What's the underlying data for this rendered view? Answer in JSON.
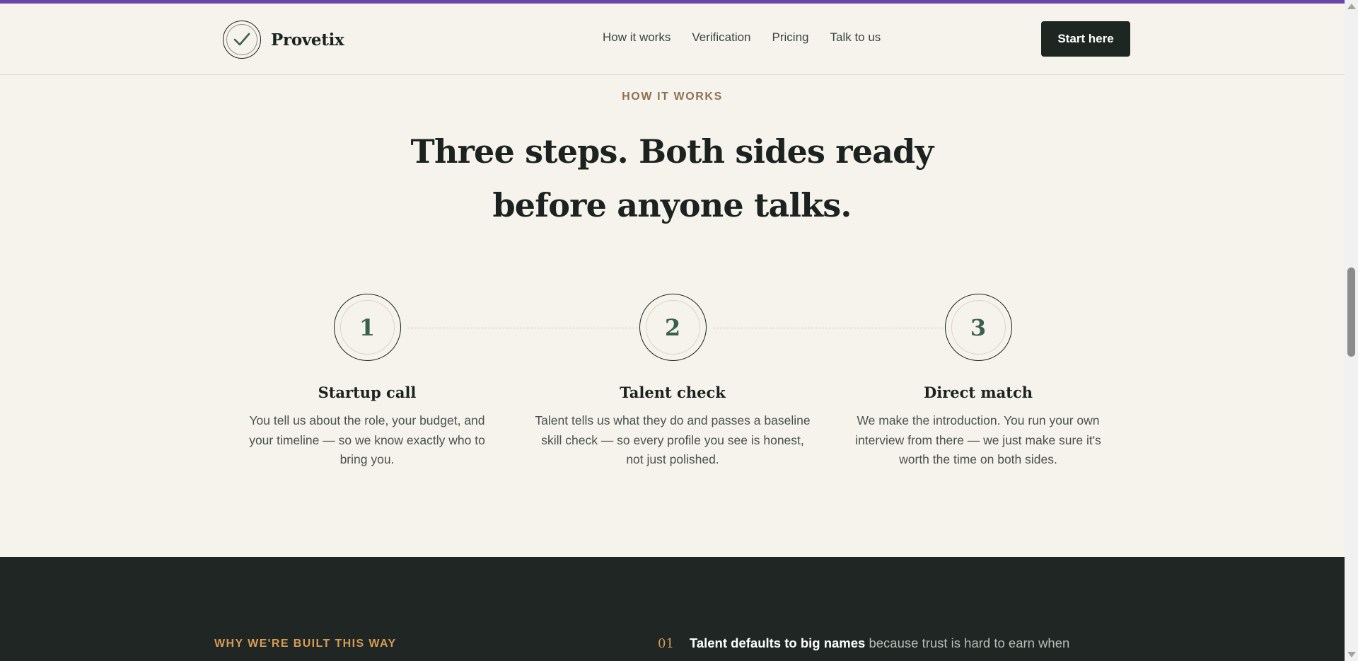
{
  "brand": {
    "name": "Provetix",
    "logo_icon": "check-mark-icon"
  },
  "nav": {
    "links": [
      "How it works",
      "Verification",
      "Pricing",
      "Talk to us"
    ],
    "cta_label": "Start here"
  },
  "how_it_works": {
    "eyebrow": "HOW IT WORKS",
    "headline": "Three steps. Both sides ready before anyone talks.",
    "steps": [
      {
        "number": "1",
        "title": "Startup call",
        "text": "You tell us about the role, your budget, and your timeline — so we know exactly who to bring you."
      },
      {
        "number": "2",
        "title": "Talent check",
        "text": "Talent tells us what they do and passes a baseline skill check — so every profile you see is honest, not just polished."
      },
      {
        "number": "3",
        "title": "Direct match",
        "text": "We make the introduction. You run your own interview from there — we just make sure it's worth the time on both sides."
      }
    ]
  },
  "why": {
    "eyebrow": "WHY WE'RE BUILT THIS WAY",
    "reasons": [
      {
        "number": "01",
        "bold": "Talent defaults to big names",
        "text": " because trust is hard to earn when"
      }
    ]
  },
  "colors": {
    "page_bg": "#f6f3ec",
    "accent_bar": "#6a45a8",
    "dark_section": "#1f2623",
    "gold": "#d69b55",
    "green_numeral": "#3a5f4d"
  }
}
